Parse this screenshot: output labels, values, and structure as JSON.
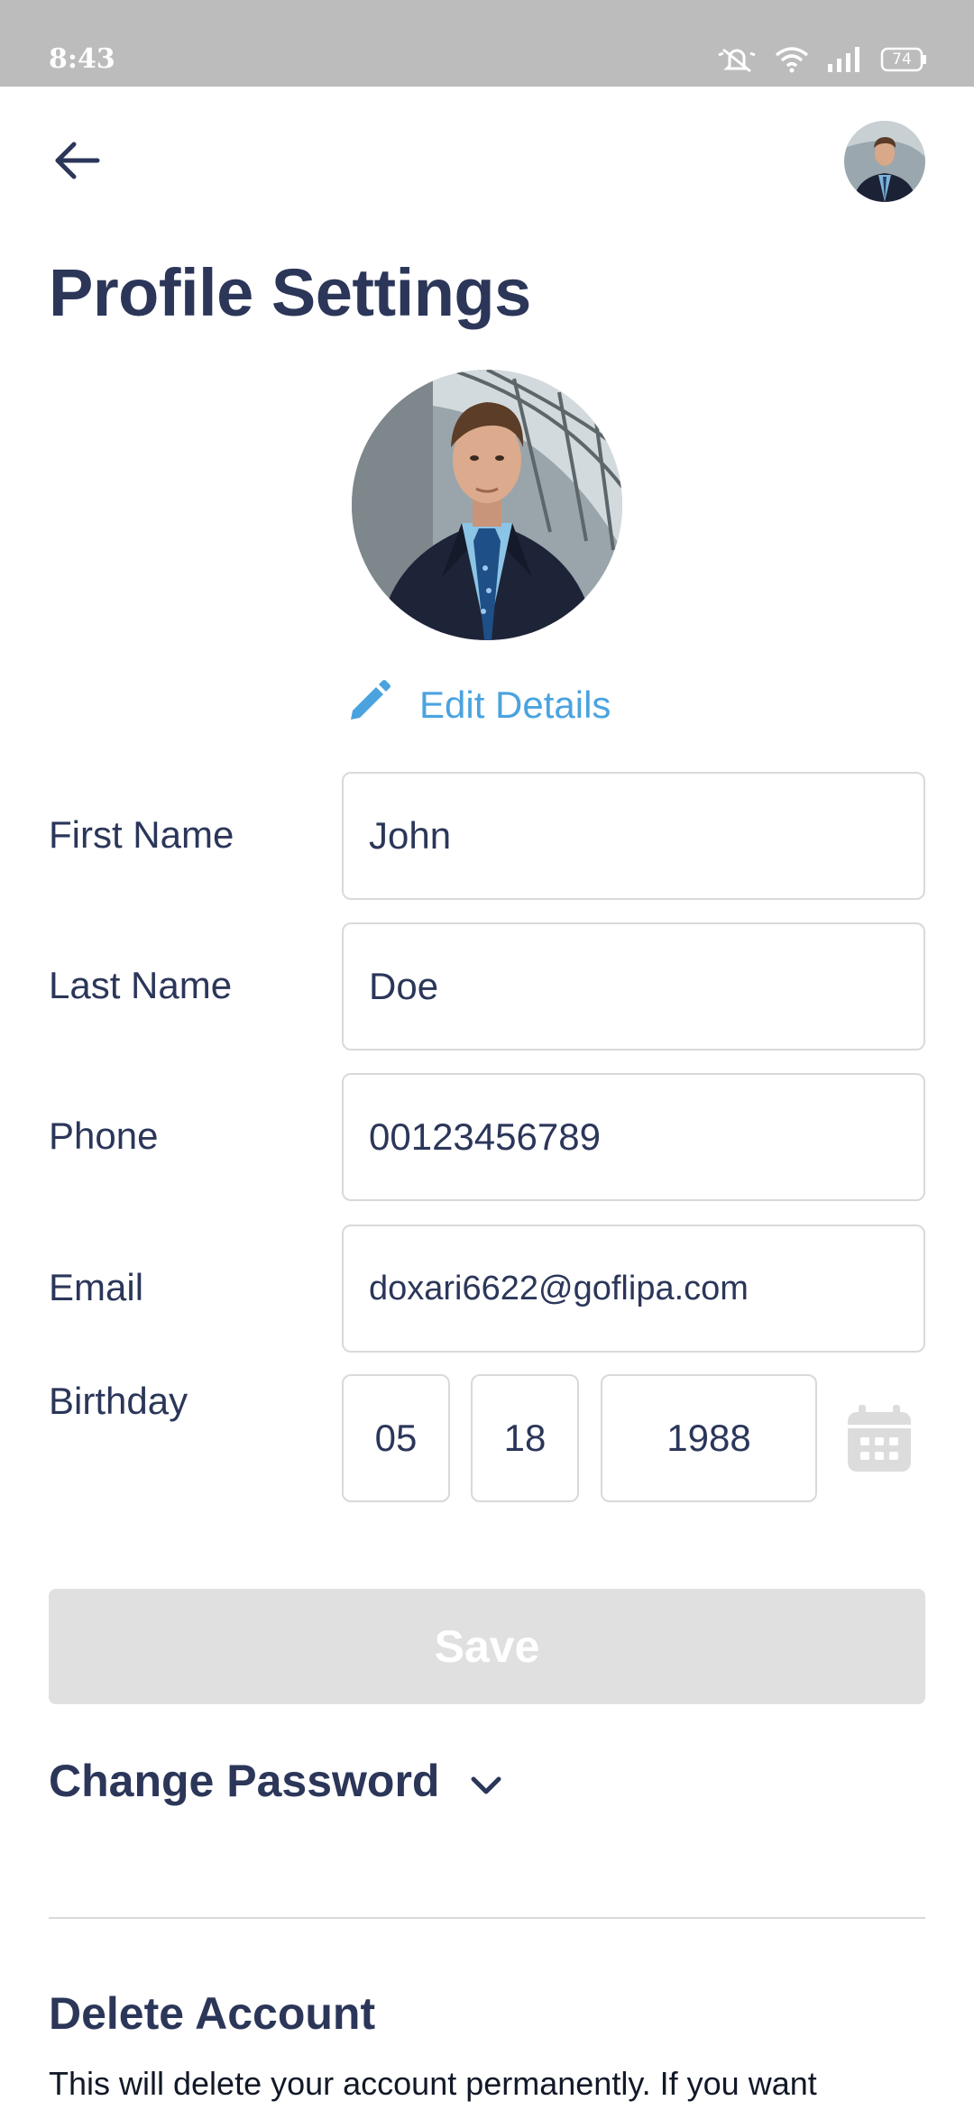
{
  "status_bar": {
    "time": "8:43",
    "battery": "74",
    "icons": [
      "mute-icon",
      "wifi-icon",
      "signal-icon",
      "battery-icon"
    ]
  },
  "header": {
    "back_icon": "arrow-left-icon",
    "avatar_icon": "user-avatar"
  },
  "page": {
    "title": "Profile Settings"
  },
  "edit": {
    "icon": "pencil-icon",
    "label": "Edit Details"
  },
  "form": {
    "first_name": {
      "label": "First Name",
      "value": "John"
    },
    "last_name": {
      "label": "Last Name",
      "value": "Doe"
    },
    "phone": {
      "label": "Phone",
      "value": "00123456789"
    },
    "email": {
      "label": "Email",
      "value": "doxari6622@goflipa.com"
    },
    "birthday": {
      "label": "Birthday",
      "month": "05",
      "day": "18",
      "year": "1988",
      "icon": "calendar-icon"
    }
  },
  "actions": {
    "save_label": "Save",
    "change_password_label": "Change Password"
  },
  "delete_account": {
    "title": "Delete Account",
    "description": "This will delete your account permanently. If you want"
  },
  "colors": {
    "primary_text": "#2b3659",
    "accent": "#4aa3df",
    "disabled_button": "#e0e0e0",
    "border": "#d9d9d9",
    "status_bar": "#bcbcbc"
  }
}
